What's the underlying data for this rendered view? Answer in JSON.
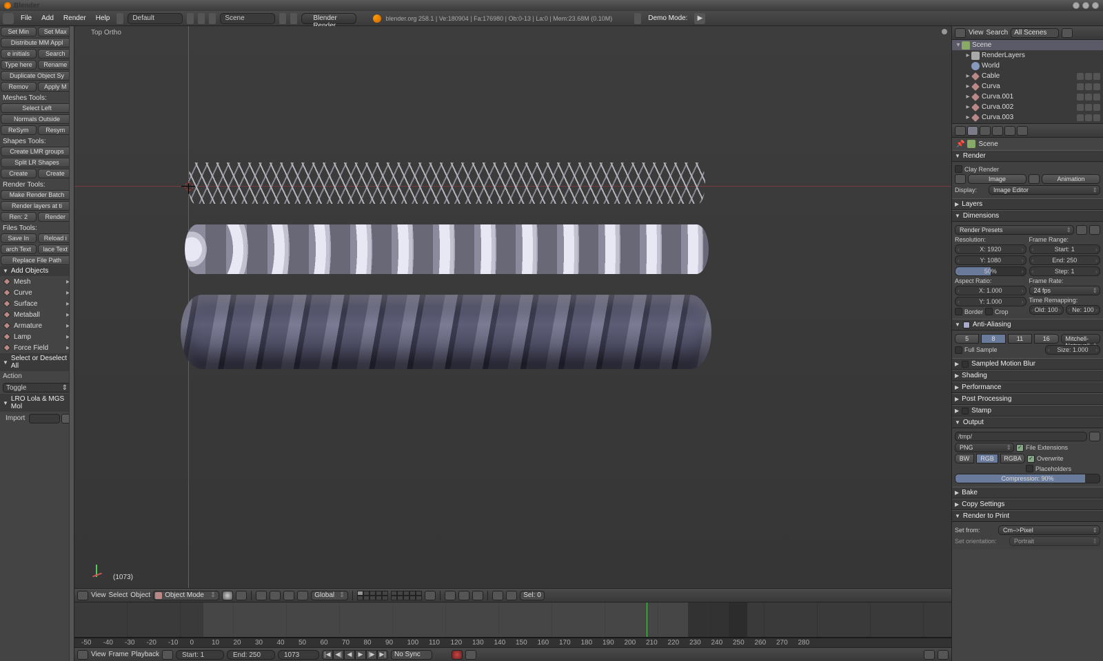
{
  "app": {
    "title": "Blender"
  },
  "top": {
    "menus": [
      "File",
      "Add",
      "Render",
      "Help"
    ],
    "layout": "Default",
    "scene": "Scene",
    "engine": "Blender Render",
    "stats": "blender.org 258.1 | Ve:180904 | Fa:176980 | Ob:0-13 | La:0 | Mem:23.68M (0.10M)",
    "demo": "Demo Mode:"
  },
  "left": {
    "top_rows": [
      [
        "Set Min",
        "Set Max"
      ],
      [
        "Distribute MM Appl"
      ],
      [
        "e initials",
        "Search"
      ],
      [
        "Type here",
        "Rename"
      ],
      [
        "Duplicate Object Sy"
      ],
      [
        "Remov",
        "Apply M"
      ]
    ],
    "meshes_label": "Meshes Tools:",
    "meshes": [
      [
        "Select Left"
      ],
      [
        "Normals Outside"
      ],
      [
        "ReSym",
        "Resym"
      ]
    ],
    "shapes_label": "Shapes Tools:",
    "shapes": [
      [
        "Create LMR groups"
      ],
      [
        "Split LR Shapes"
      ],
      [
        "Create",
        "Create"
      ]
    ],
    "render_label": "Render Tools:",
    "render": [
      [
        "Make Render Batch"
      ],
      [
        "Render layers at ti"
      ],
      [
        "Ren: 2",
        "Render"
      ]
    ],
    "files_label": "Files Tools:",
    "files": [
      [
        "Save In",
        "Reload i"
      ],
      [
        "arch Text",
        "lace Text"
      ],
      [
        "Replace File Path"
      ]
    ],
    "add_header": "Add Objects",
    "add_items": [
      "Mesh",
      "Curve",
      "Surface",
      "Metaball",
      "Armature",
      "Lamp",
      "Force Field"
    ],
    "select_header": "Select or Deselect All",
    "action_label": "Action",
    "action_value": "Toggle",
    "lro_header": "LRO Lola & MGS Mol",
    "import_label": "Import"
  },
  "viewport": {
    "view_label": "Top Ortho",
    "frame_overlay": "(1073)"
  },
  "view3d_header": {
    "menus": [
      "View",
      "Select",
      "Object"
    ],
    "mode": "Object Mode",
    "orient": "Global",
    "sel": "Sel: 0"
  },
  "timeline": {
    "menus": [
      "View",
      "Frame",
      "Playback"
    ],
    "start": "Start: 1",
    "end": "End: 250",
    "current": "1073",
    "sync": "No Sync",
    "ticks": [
      "-50",
      "-40",
      "-30",
      "-20",
      "-10",
      "0",
      "10",
      "20",
      "30",
      "40",
      "50",
      "60",
      "70",
      "80",
      "90",
      "100",
      "110",
      "120",
      "130",
      "140",
      "150",
      "160",
      "170",
      "180",
      "190",
      "200",
      "210",
      "220",
      "230",
      "240",
      "250",
      "260",
      "270",
      "280"
    ]
  },
  "outliner": {
    "menus": [
      "View",
      "Search"
    ],
    "filter": "All Scenes",
    "tree": [
      {
        "indent": 0,
        "exp": "▾",
        "type": "scene",
        "name": "Scene",
        "selected": true
      },
      {
        "indent": 1,
        "exp": "▸",
        "type": "rl",
        "name": "RenderLayers"
      },
      {
        "indent": 1,
        "exp": "",
        "type": "world",
        "name": "World"
      },
      {
        "indent": 1,
        "exp": "▸",
        "type": "obj",
        "name": "Cable",
        "restrict": true
      },
      {
        "indent": 1,
        "exp": "▸",
        "type": "obj",
        "name": "Curva",
        "restrict": true
      },
      {
        "indent": 1,
        "exp": "▸",
        "type": "obj",
        "name": "Curva.001",
        "restrict": true
      },
      {
        "indent": 1,
        "exp": "▸",
        "type": "obj",
        "name": "Curva.002",
        "restrict": true
      },
      {
        "indent": 1,
        "exp": "▸",
        "type": "obj",
        "name": "Curva.003",
        "restrict": true
      }
    ]
  },
  "props": {
    "breadcrumb": "Scene",
    "render_h": "Render",
    "render": {
      "clay": "Clay Render",
      "image": "Image",
      "animation": "Animation",
      "display_l": "Display:",
      "display": "Image Editor"
    },
    "layers_h": "Layers",
    "dimensions_h": "Dimensions",
    "dim": {
      "presets": "Render Presets",
      "res_l": "Resolution:",
      "fr_l": "Frame Range:",
      "x": "X: 1920",
      "start": "Start: 1",
      "y": "Y: 1080",
      "end": "End: 250",
      "pct": "50%",
      "step": "Step: 1",
      "ar_l": "Aspect Ratio:",
      "frr_l": "Frame Rate:",
      "arx": "X: 1.000",
      "fps": "24 fps",
      "ary": "Y: 1.000",
      "tr_l": "Time Remapping:",
      "border": "Border",
      "crop": "Crop",
      "old": "Old: 100",
      "new": "Ne: 100"
    },
    "aa_h": "Anti-Aliasing",
    "aa": {
      "s5": "5",
      "s8": "8",
      "s11": "11",
      "s16": "16",
      "filter": "Mitchell-Netravali",
      "full": "Full Sample",
      "size": "Size: 1.000"
    },
    "smb_h": "Sampled Motion Blur",
    "shading_h": "Shading",
    "perf_h": "Performance",
    "pp_h": "Post Processing",
    "stamp_h": "Stamp",
    "output_h": "Output",
    "output": {
      "path": "/tmp/",
      "format": "PNG",
      "fe": "File Extensions",
      "bw": "BW",
      "rgb": "RGB",
      "rgba": "RGBA",
      "ow": "Overwrite",
      "ph": "Placeholders",
      "comp": "Compression: 90%"
    },
    "bake_h": "Bake",
    "copy_h": "Copy Settings",
    "r2p_h": "Render to Print",
    "r2p": {
      "from_l": "Set from:",
      "from": "Cm–>Pixel",
      "orient_l": "Set orientation:",
      "orient": "Portrait"
    }
  }
}
